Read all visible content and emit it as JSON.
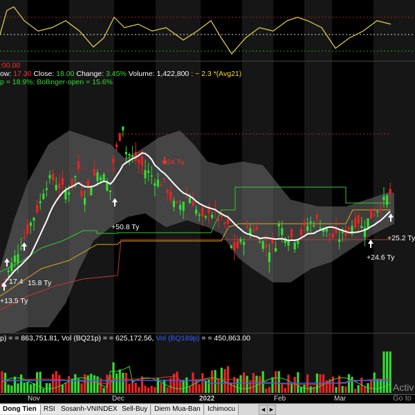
{
  "price_info": {
    "low_label": "ow:",
    "low_value": "17.30",
    "close_label": "Close:",
    "close_value": "18.00",
    "change_label": "Change:",
    "change_value": "3.45%",
    "volume_label": "Volume:",
    "volume_value": "1,422,800",
    "avg_text": ": ~ 2.3 *(Avg21)",
    "bollinger_text": "p = 18.9%;",
    "bollinger_open_text": "Bollinger-open = 15.6%",
    "time_text": ":00.00"
  },
  "volume_info": {
    "vol_text": "p) = = 863,751.81, Vol (BQ21p) = = 625,172.56,",
    "vol_blue_text": "Vol (BQ189p)",
    "vol_tail_text": "= = 450,863.00"
  },
  "annotations": {
    "a1": "+50.8 Ty",
    "a2": "24 Ty",
    "a3": "+25.2 Ty",
    "a4": "+24.6 Ty",
    "a5": "17.4",
    "a6": "15.8 Ty",
    "a7": "+13.5 Ty"
  },
  "x_axis": {
    "labels": [
      "Nov",
      "Dec",
      "2022",
      "Feb",
      "Mar"
    ]
  },
  "tabs": [
    {
      "label": "Dong Tien",
      "active": true
    },
    {
      "label": "RSI",
      "active": false
    },
    {
      "label": "Sosanh-VNINDEX",
      "active": false
    },
    {
      "label": "Sell-Buy",
      "active": false
    },
    {
      "label": "Diem Mua-Ban",
      "active": false
    },
    {
      "label": "Ichimocu",
      "active": false
    }
  ],
  "nav": {
    "prev": "◄",
    "next": "►"
  },
  "watermark": {
    "line1": "Activ",
    "line2": "Go to"
  },
  "colors": {
    "up": "#33dd33",
    "down": "#ee2222",
    "ma": "#ffffff",
    "band": "#6e6e6e",
    "rsi_line": "#e6d84a",
    "label_red": "#ff3030",
    "label_green": "#33dd33",
    "label_blue": "#2f5fff",
    "label_yellow": "#ffdd33"
  }
}
